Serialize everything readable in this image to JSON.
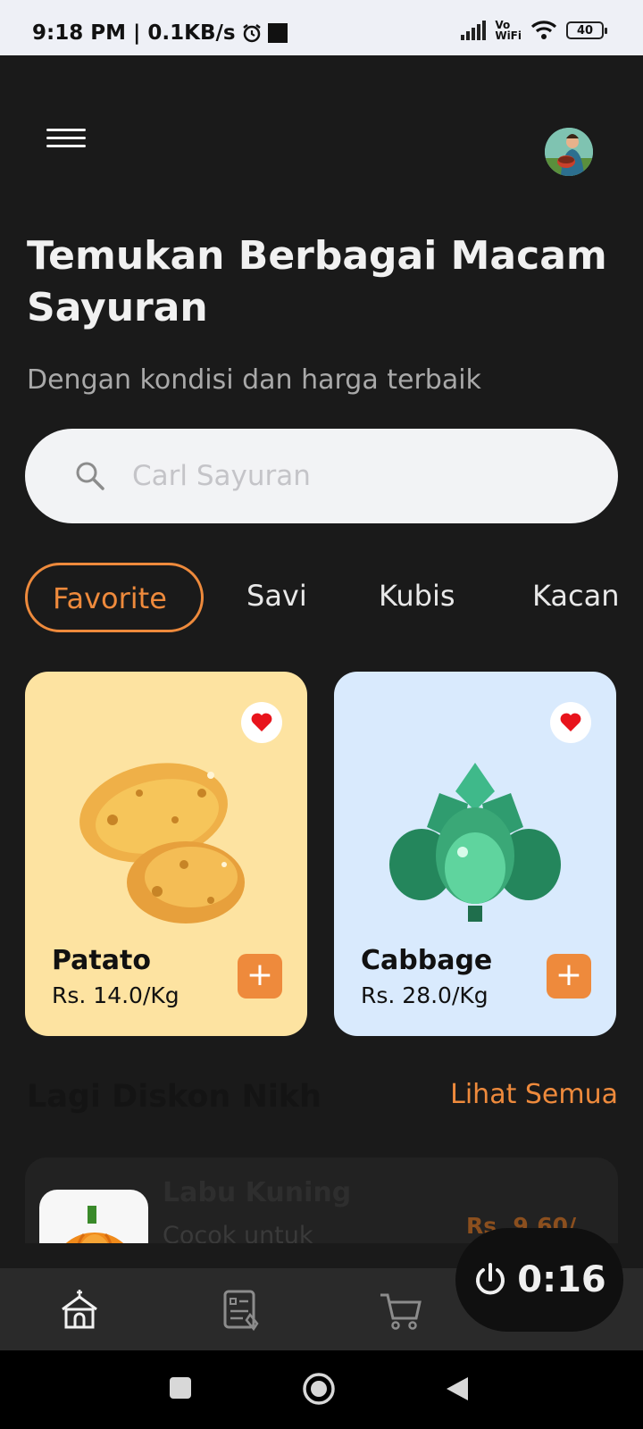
{
  "status_bar": {
    "time_speed": "9:18 PM | 0.1KB/s",
    "vowifi_top": "Vo",
    "vowifi_bottom": "WiFi",
    "battery": "40"
  },
  "header": {
    "title": "Temukan Berbagai Macam Sayuran",
    "subtitle": "Dengan kondisi dan harga terbaik"
  },
  "search": {
    "placeholder": "Carl Sayuran"
  },
  "tabs": [
    {
      "label": "Favorite",
      "active": true
    },
    {
      "label": "Savi",
      "active": false
    },
    {
      "label": "Kubis",
      "active": false
    },
    {
      "label": "Kacang",
      "active": false
    }
  ],
  "products": [
    {
      "name": "Patato",
      "price": "Rs. 14.0/Kg"
    },
    {
      "name": "Cabbage",
      "price": "Rs. 28.0/Kg"
    }
  ],
  "discount": {
    "title": "Lagi Diskon Nikh",
    "see_all": "Lihat Semua",
    "items": [
      {
        "name": "Labu Kuning",
        "desc": "Cocok untuk",
        "price": "Rs. 9.60/"
      }
    ]
  },
  "timer": {
    "value": "0:16"
  },
  "colors": {
    "accent": "#ee8a3c",
    "potato_card": "#fde3a1",
    "cabbage_card": "#d9eafd",
    "background": "#1a1a1a"
  }
}
